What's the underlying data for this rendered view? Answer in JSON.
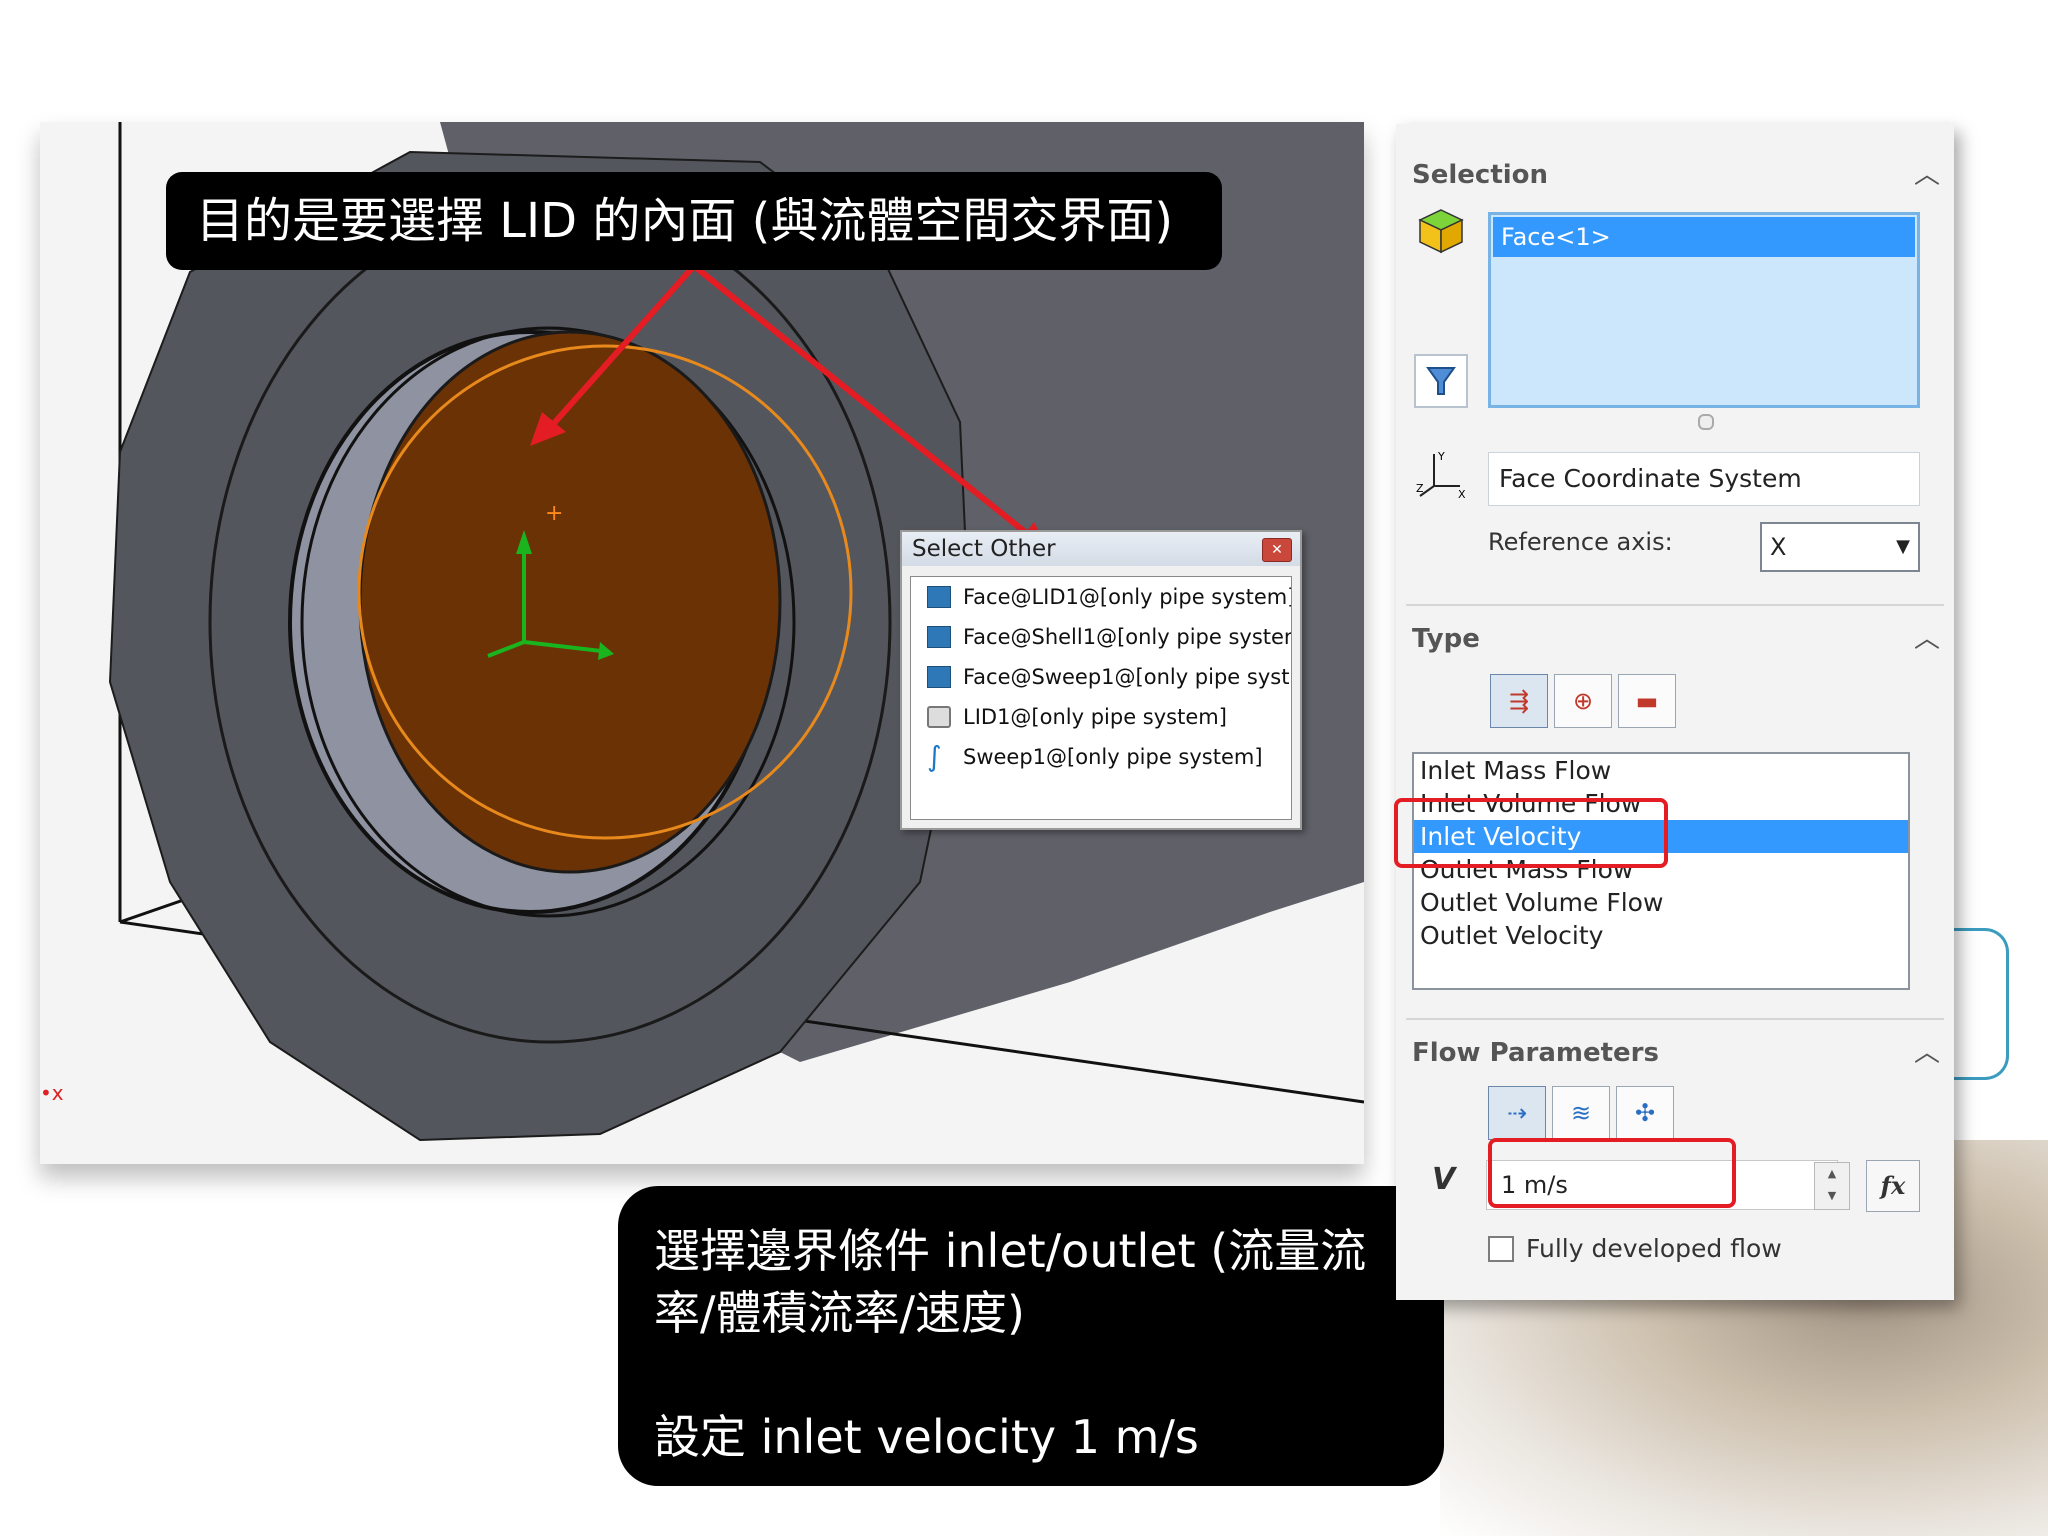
{
  "callouts": {
    "top": "目的是要選擇 LID 的內面 (與流體空間交界面)",
    "bottom_line1": "選擇邊界條件  inlet/outlet (流量流",
    "bottom_line2": "率/體積流率/速度)",
    "bottom_line3": "設定 inlet velocity 1 m/s"
  },
  "select_other": {
    "title": "Select Other",
    "items": [
      {
        "label": "Face@LID1@[only pipe system]",
        "icon": "face-icon"
      },
      {
        "label": "Face@Shell1@[only pipe systen",
        "icon": "face-icon"
      },
      {
        "label": "Face@Sweep1@[only pipe syst",
        "icon": "face-icon"
      },
      {
        "label": "LID1@[only pipe system]",
        "icon": "part-icon"
      },
      {
        "label": "Sweep1@[only pipe system]",
        "icon": "sweep-icon"
      }
    ]
  },
  "panel": {
    "selection": {
      "title": "Selection",
      "selected_item": "Face<1>",
      "coordinate_system": "Face Coordinate System",
      "reference_axis_label": "Reference axis:",
      "reference_axis_value": "X"
    },
    "type": {
      "title": "Type",
      "list": [
        "Inlet Mass Flow",
        "Inlet Volume Flow",
        "Inlet Velocity",
        "Outlet Mass Flow",
        "Outlet Volume Flow",
        "Outlet Velocity"
      ],
      "selected": "Inlet Velocity"
    },
    "flow_parameters": {
      "title": "Flow Parameters",
      "value_symbol": "V",
      "value": "1 m/s",
      "fx_label": "fx",
      "fully_developed_label": "Fully developed flow",
      "fully_developed_checked": false
    }
  },
  "colors": {
    "highlight_face": "#6b3206",
    "selection_blue": "#3399ff",
    "annotation_red": "#e41c24",
    "part_gray": "#5e6068"
  }
}
